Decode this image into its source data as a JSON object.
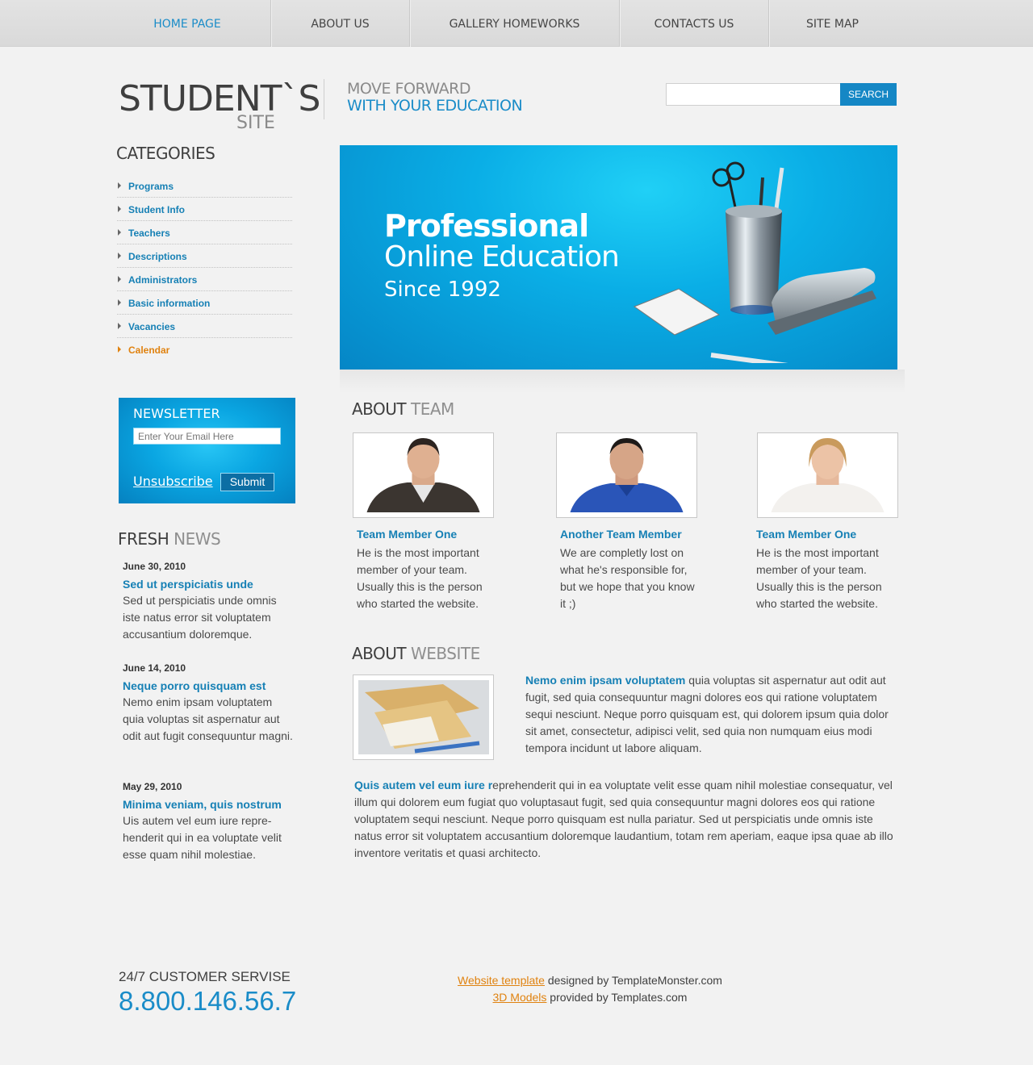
{
  "nav": {
    "items": [
      {
        "label": "HOME PAGE"
      },
      {
        "label": "ABOUT US"
      },
      {
        "label": "GALLERY HOMEWORKS"
      },
      {
        "label": "CONTACTS US"
      },
      {
        "label": "SITE MAP"
      }
    ]
  },
  "header": {
    "logo_main": "STUDENT`S",
    "logo_sub": "SITE",
    "slogan_line1": "MOVE FORWARD",
    "slogan_line2": "WITH YOUR EDUCATION",
    "search_button": "SEARCH",
    "search_value": ""
  },
  "categories": {
    "title": "CATEGORIES",
    "items": [
      {
        "label": "Programs"
      },
      {
        "label": "Student Info"
      },
      {
        "label": "Teachers"
      },
      {
        "label": "Descriptions"
      },
      {
        "label": "Administrators"
      },
      {
        "label": "Basic information"
      },
      {
        "label": "Vacancies"
      },
      {
        "label": "Calendar"
      }
    ]
  },
  "newsletter": {
    "title": "NEWSLETTER",
    "email_placeholder": "Enter Your Email Here",
    "unsubscribe": "Unsubscribe",
    "submit": "Submit"
  },
  "news": {
    "title_dark": "FRESH",
    "title_light": "NEWS",
    "items": [
      {
        "date": "June 30, 2010",
        "title": "Sed ut perspiciatis unde",
        "text": "Sed ut perspiciatis unde omnis iste natus error sit voluptatem accusantium doloremque."
      },
      {
        "date": "June 14, 2010",
        "title": "Neque porro quisquam est",
        "text": "Nemo enim ipsam voluptatem quia voluptas sit aspernatur aut odit aut fugit consequuntur magni."
      },
      {
        "date": "May 29, 2010",
        "title": "Minima veniam, quis nostrum",
        "text": "Uis autem vel eum iure repre-henderit qui in ea voluptate velit esse quam nihil molestiae."
      }
    ]
  },
  "banner": {
    "line1": "Professional",
    "line2": "Online Education",
    "line3": "Since 1992"
  },
  "team": {
    "title_dark": "ABOUT",
    "title_light": "TEAM",
    "members": [
      {
        "name": "Team Member One",
        "text": "He is the most important member of your team. Usually this is the person who started the website."
      },
      {
        "name": "Another Team Member",
        "text": "We are completly lost on what he's responsible for, but we hope that you know it ;)"
      },
      {
        "name": "Team Member One",
        "text": "He is the most important member of your team. Usually this is the person who started the website."
      }
    ]
  },
  "website": {
    "title_dark": "ABOUT",
    "title_light": "WEBSITE",
    "p1_highlight": "Nemo enim ipsam voluptatem",
    "p1_text": " quia voluptas sit aspernatur aut odit aut fugit, sed quia consequuntur magni dolores eos qui ratione voluptatem sequi nesciunt. Neque porro quisquam est, qui dolorem ipsum quia dolor sit amet, consectetur, adipisci velit, sed quia non numquam eius modi tempora incidunt ut labore aliquam.",
    "p2_highlight": "Quis autem vel eum iure r",
    "p2_text": "eprehenderit qui in ea voluptate velit esse quam nihil molestiae consequatur, vel illum qui dolorem eum fugiat quo voluptasaut fugit, sed quia consequuntur magni dolores eos qui ratione voluptatem sequi nesciunt. Neque porro quisquam est nulla pariatur. Sed ut perspiciatis unde omnis iste natus error sit voluptatem accusantium doloremque laudantium, totam rem aperiam, eaque ipsa quae ab illo inventore veritatis et quasi architecto."
  },
  "footer": {
    "service": "24/7 CUSTOMER SERVISE",
    "phone": "8.800.146.56.7",
    "credit1_link": "Website template",
    "credit1_text": " designed by TemplateMonster.com",
    "credit2_link": "3D Models",
    "credit2_text": " provided by Templates.com"
  },
  "colors": {
    "accent": "#1a8cc8",
    "highlight_orange": "#e0820f",
    "background": "#f2f2f2"
  }
}
